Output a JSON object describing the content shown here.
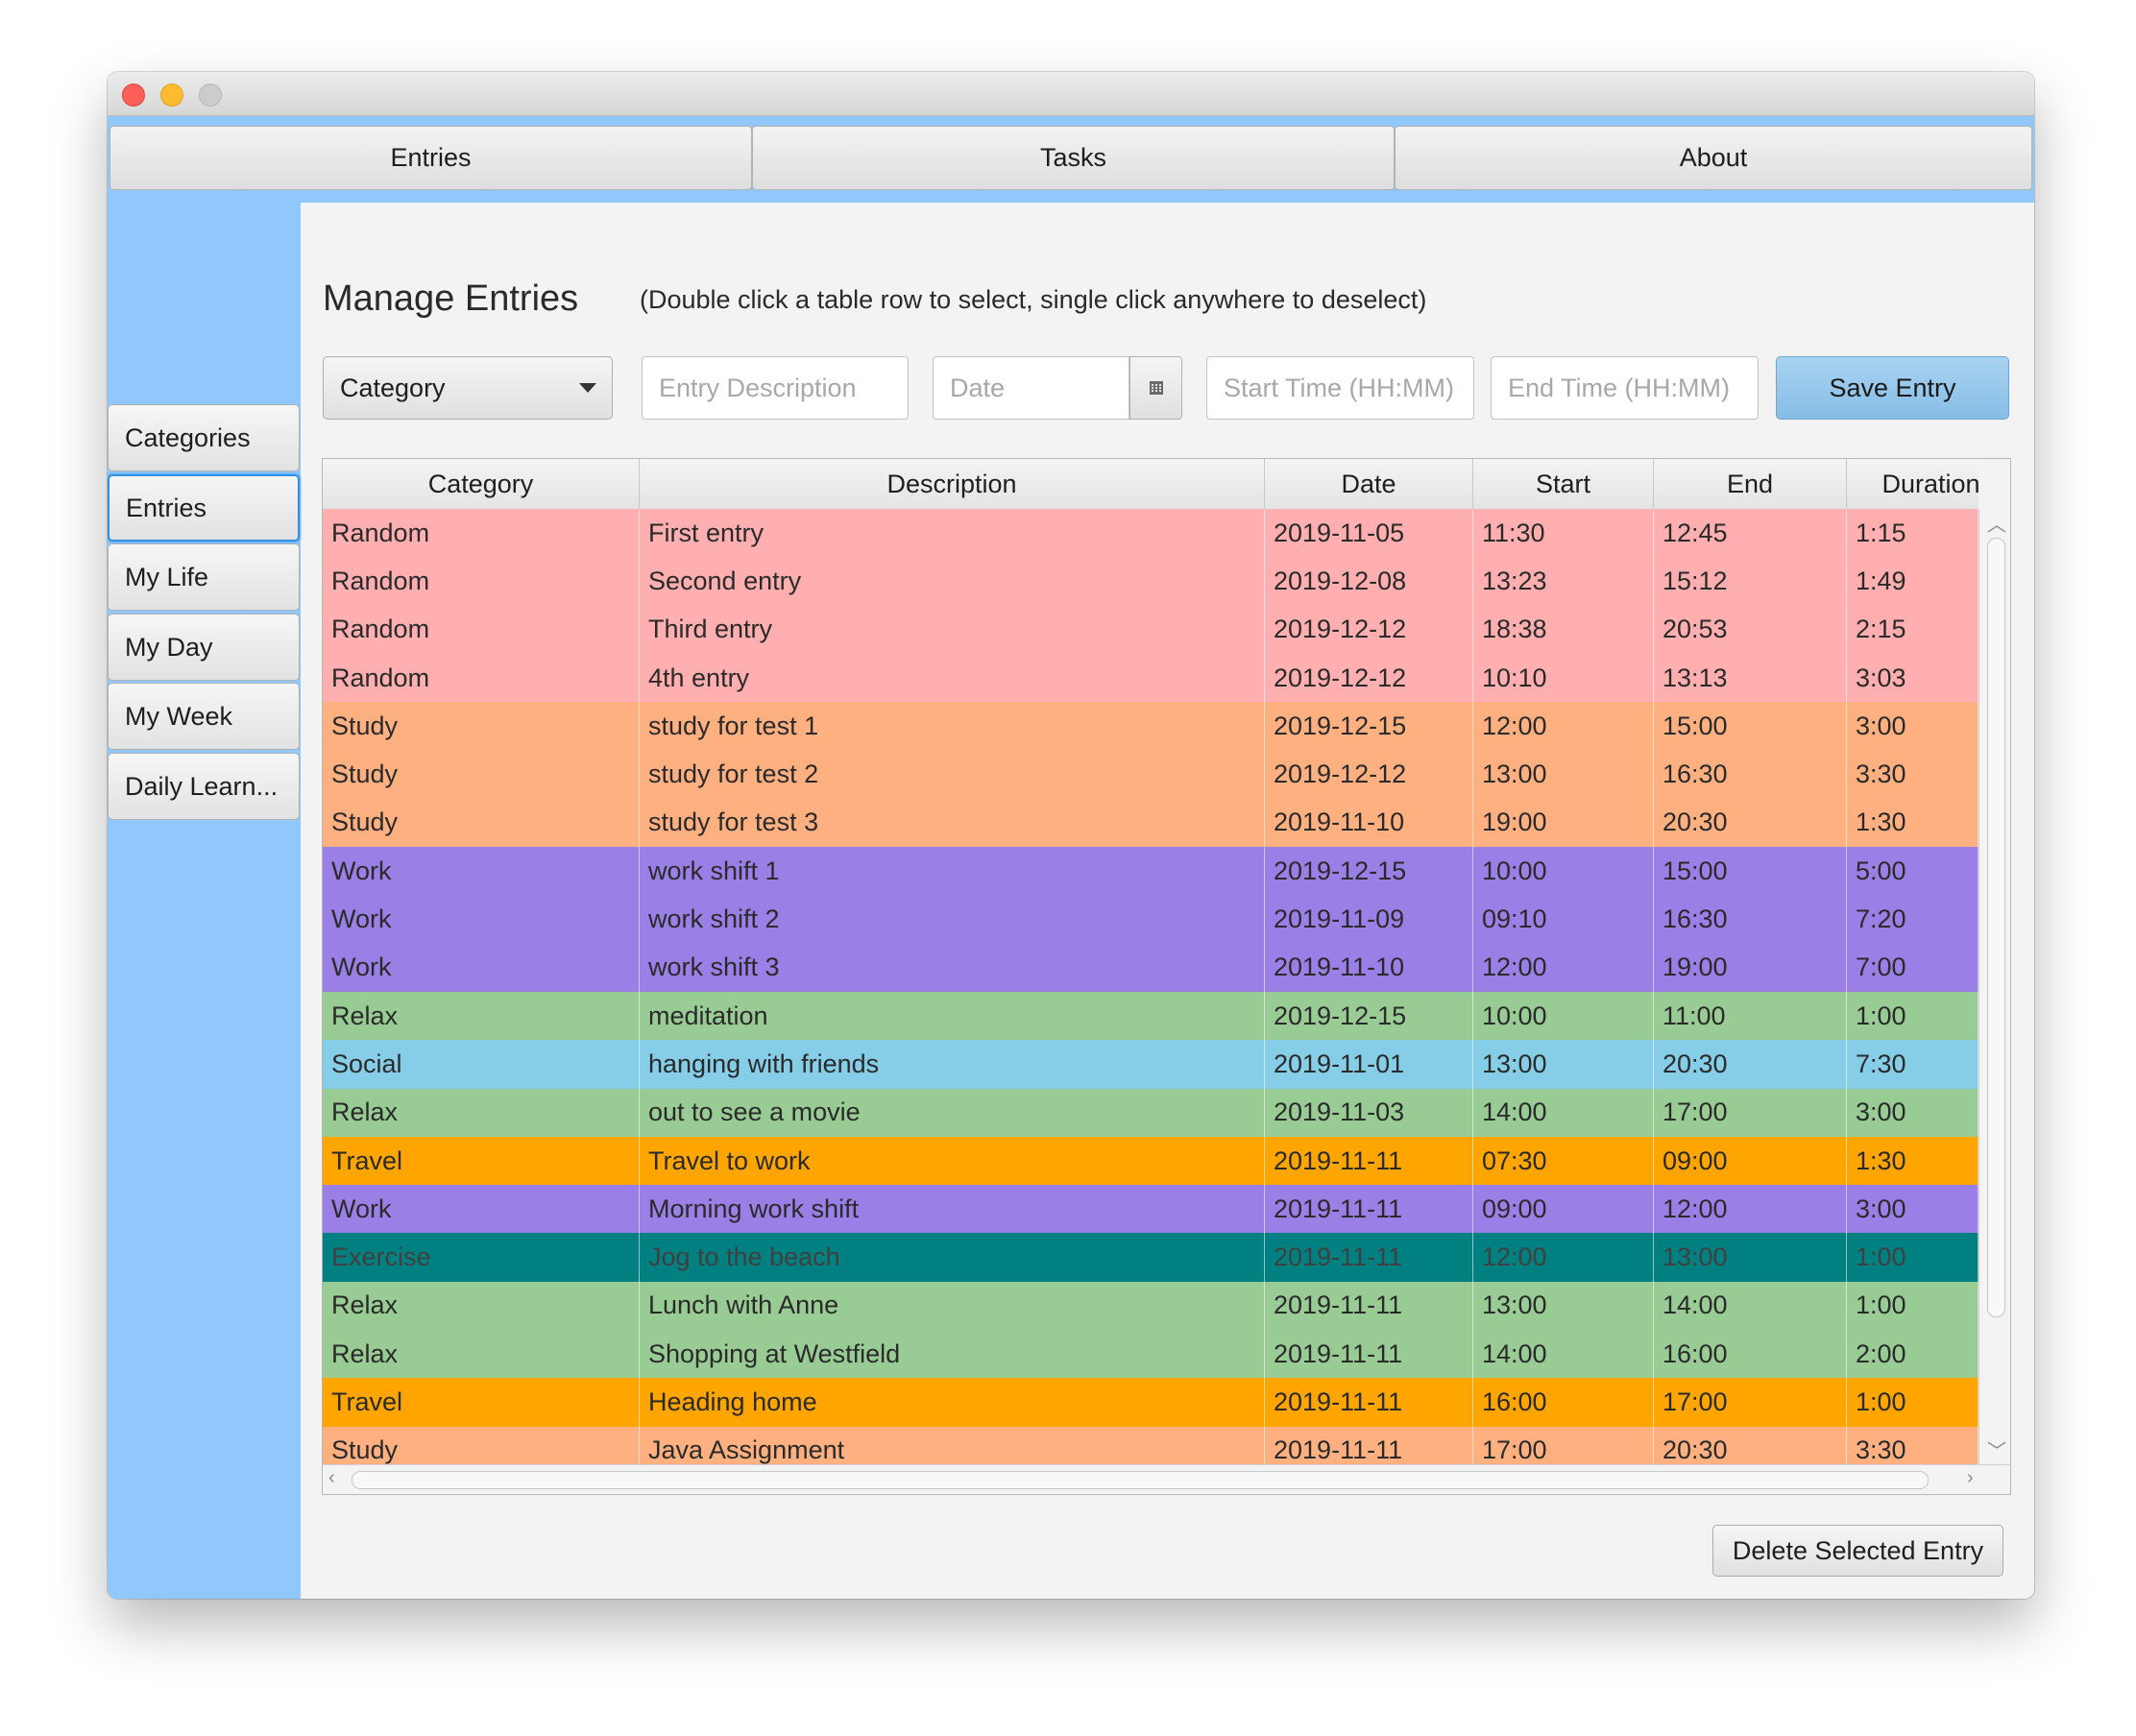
{
  "window": {
    "top_tabs": [
      {
        "label": "Entries"
      },
      {
        "label": "Tasks"
      },
      {
        "label": "About"
      }
    ]
  },
  "sidebar": {
    "items": [
      {
        "label": "Categories",
        "active": false
      },
      {
        "label": "Entries",
        "active": true
      },
      {
        "label": "My Life",
        "active": false
      },
      {
        "label": "My Day",
        "active": false
      },
      {
        "label": "My Week",
        "active": false
      },
      {
        "label": "Daily Learn...",
        "active": false
      }
    ]
  },
  "main": {
    "title": "Manage Entries",
    "hint": "(Double click a table row to select, single click anywhere to deselect)",
    "form": {
      "category_value": "Category",
      "description_placeholder": "Entry Description",
      "date_placeholder": "Date",
      "start_placeholder": "Start Time (HH:MM)",
      "end_placeholder": "End Time (HH:MM)",
      "calendar_icon": "calendar-icon",
      "save_label": "Save Entry"
    },
    "table": {
      "columns": [
        "Category",
        "Description",
        "Date",
        "Start",
        "End",
        "Duration"
      ],
      "category_colors": {
        "Random": "#ffafb0",
        "Study": "#ffb081",
        "Work": "#9a7fe6",
        "Relax": "#99cc95",
        "Social": "#86cee8",
        "Travel": "#ffa500",
        "Exercise": "#008080"
      },
      "rows": [
        [
          "Random",
          "First entry",
          "2019-11-05",
          "11:30",
          "12:45",
          "1:15"
        ],
        [
          "Random",
          "Second entry",
          "2019-12-08",
          "13:23",
          "15:12",
          "1:49"
        ],
        [
          "Random",
          "Third entry",
          "2019-12-12",
          "18:38",
          "20:53",
          "2:15"
        ],
        [
          "Random",
          "4th entry",
          "2019-12-12",
          "10:10",
          "13:13",
          "3:03"
        ],
        [
          "Study",
          "study for test 1",
          "2019-12-15",
          "12:00",
          "15:00",
          "3:00"
        ],
        [
          "Study",
          "study for test 2",
          "2019-12-12",
          "13:00",
          "16:30",
          "3:30"
        ],
        [
          "Study",
          "study for test 3",
          "2019-11-10",
          "19:00",
          "20:30",
          "1:30"
        ],
        [
          "Work",
          "work shift 1",
          "2019-12-15",
          "10:00",
          "15:00",
          "5:00"
        ],
        [
          "Work",
          "work shift 2",
          "2019-11-09",
          "09:10",
          "16:30",
          "7:20"
        ],
        [
          "Work",
          "work shift 3",
          "2019-11-10",
          "12:00",
          "19:00",
          "7:00"
        ],
        [
          "Relax",
          "meditation",
          "2019-12-15",
          "10:00",
          "11:00",
          "1:00"
        ],
        [
          "Social",
          "hanging with friends",
          "2019-11-01",
          "13:00",
          "20:30",
          "7:30"
        ],
        [
          "Relax",
          "out to see a movie",
          "2019-11-03",
          "14:00",
          "17:00",
          "3:00"
        ],
        [
          "Travel",
          "Travel to work",
          "2019-11-11",
          "07:30",
          "09:00",
          "1:30"
        ],
        [
          "Work",
          "Morning work shift",
          "2019-11-11",
          "09:00",
          "12:00",
          "3:00"
        ],
        [
          "Exercise",
          "Jog to the beach",
          "2019-11-11",
          "12:00",
          "13:00",
          "1:00"
        ],
        [
          "Relax",
          "Lunch with Anne",
          "2019-11-11",
          "13:00",
          "14:00",
          "1:00"
        ],
        [
          "Relax",
          "Shopping at Westfield",
          "2019-11-11",
          "14:00",
          "16:00",
          "2:00"
        ],
        [
          "Travel",
          "Heading home",
          "2019-11-11",
          "16:00",
          "17:00",
          "1:00"
        ],
        [
          "Study",
          "Java Assignment",
          "2019-11-11",
          "17:00",
          "20:30",
          "3:30"
        ]
      ]
    },
    "delete_label": "Delete Selected Entry"
  }
}
